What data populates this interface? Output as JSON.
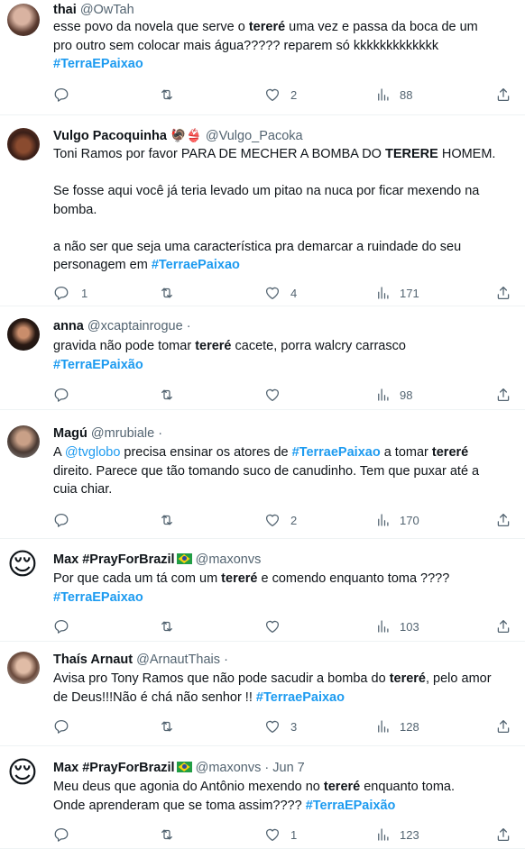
{
  "tweets": [
    {
      "name": "thai",
      "handle": "@OwTah",
      "date": "",
      "lines": [
        [
          {
            "t": "esse povo da novela que serve o "
          },
          {
            "t": "tereré",
            "s": "b"
          },
          {
            "t": " uma vez e passa da boca de um"
          }
        ],
        [
          {
            "t": "pro outro sem colocar mais água????? reparem só kkkkkkkkkkkkk"
          }
        ],
        [
          {
            "t": "#TerraEPaixao",
            "s": "tag"
          }
        ]
      ],
      "replies": "",
      "retweets": "",
      "likes": "2",
      "views": "88"
    },
    {
      "name": "Vulgo Pacoquinha",
      "name_emoji": "🦃👙",
      "handle": "@Vulgo_Pacoka",
      "date": "",
      "lines": [
        [
          {
            "t": "Toni Ramos por favor PARA DE MECHER A BOMBA DO "
          },
          {
            "t": "TERERE",
            "s": "b"
          },
          {
            "t": " HOMEM."
          }
        ],
        [],
        [
          {
            "t": "Se fosse aqui você já teria levado um pitao na nuca por ficar mexendo na"
          }
        ],
        [
          {
            "t": "bomba."
          }
        ],
        [],
        [
          {
            "t": "a não ser que seja uma característica pra demarcar a ruindade do seu"
          }
        ],
        [
          {
            "t": "personagem em "
          },
          {
            "t": "#TerraePaixao",
            "s": "tag"
          }
        ]
      ],
      "replies": "1",
      "retweets": "",
      "likes": "4",
      "views": "171"
    },
    {
      "name": "anna",
      "handle": "@xcaptainrogue",
      "date": "·",
      "lines": [
        [
          {
            "t": "gravida não pode tomar "
          },
          {
            "t": "tereré",
            "s": "b"
          },
          {
            "t": " cacete, porra walcry carrasco"
          }
        ],
        [
          {
            "t": "#TerraEPaixão",
            "s": "tag"
          }
        ]
      ],
      "replies": "",
      "retweets": "",
      "likes": "",
      "views": "98"
    },
    {
      "name": "Magú",
      "handle": "@mrubiale",
      "date": "·",
      "lines": [
        [
          {
            "t": "A "
          },
          {
            "t": "@tvglobo",
            "s": "mention"
          },
          {
            "t": " precisa ensinar os atores de "
          },
          {
            "t": "#TerraePaixao",
            "s": "tag"
          },
          {
            "t": " a tomar "
          },
          {
            "t": "tereré",
            "s": "b"
          }
        ],
        [
          {
            "t": "direito. Parece que tão tomando suco de canudinho. Tem que puxar até a"
          }
        ],
        [
          {
            "t": "cuia chiar."
          }
        ]
      ],
      "replies": "",
      "retweets": "",
      "likes": "2",
      "views": "170"
    },
    {
      "name": "Max #PrayForBrazil",
      "handle": "@maxonvs",
      "date": "",
      "lines": [
        [
          {
            "t": "Por que cada um tá com um "
          },
          {
            "t": "tereré",
            "s": "b"
          },
          {
            "t": " e comendo enquanto toma ????"
          }
        ],
        [
          {
            "t": "#TerraEPaixao",
            "s": "tag"
          }
        ]
      ],
      "replies": "",
      "retweets": "",
      "likes": "",
      "views": "103"
    },
    {
      "name": "Thaís Arnaut",
      "handle": "@ArnautThais",
      "date": "·",
      "lines": [
        [
          {
            "t": "Avisa pro Tony Ramos que não pode sacudir a bomba do "
          },
          {
            "t": "tereré",
            "s": "b"
          },
          {
            "t": ", pelo amor"
          }
        ],
        [
          {
            "t": "de Deus!!!Não é chá não senhor !! "
          },
          {
            "t": "#TerraePaixao",
            "s": "tag"
          }
        ]
      ],
      "replies": "",
      "retweets": "",
      "likes": "3",
      "views": "128"
    },
    {
      "name": "Max #PrayForBrazil",
      "handle": "@maxonvs",
      "date": "· Jun 7",
      "lines": [
        [
          {
            "t": "Meu deus que agonia do Antônio mexendo no "
          },
          {
            "t": "tereré",
            "s": "b"
          },
          {
            "t": " enquanto toma."
          }
        ],
        [
          {
            "t": "Onde aprenderam que se toma assim???? "
          },
          {
            "t": "#TerraEPaixão",
            "s": "tag"
          }
        ]
      ],
      "replies": "",
      "retweets": "",
      "likes": "1",
      "views": "123"
    }
  ],
  "avatar_emoji": "😌",
  "colors": {
    "accent": "#1d9bf0",
    "text": "#0f1419",
    "muted": "#536471",
    "divider": "#eff3f4"
  }
}
